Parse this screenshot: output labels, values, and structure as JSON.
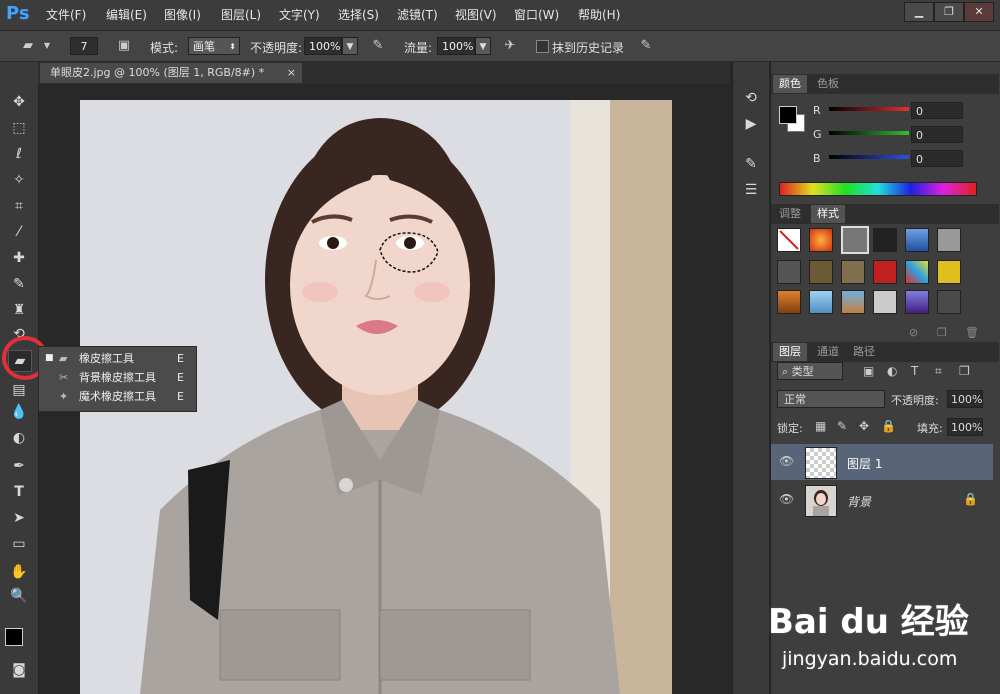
{
  "app": {
    "logo": "Ps"
  },
  "menu": [
    "文件(F)",
    "编辑(E)",
    "图像(I)",
    "图层(L)",
    "文字(Y)",
    "选择(S)",
    "滤镜(T)",
    "视图(V)",
    "窗口(W)",
    "帮助(H)"
  ],
  "window_controls": [
    "minimize-icon",
    "restore-icon",
    "close-icon"
  ],
  "options": {
    "brush_size": "7",
    "mode_label": "模式:",
    "mode_value": "画笔",
    "opacity_label": "不透明度:",
    "opacity_value": "100%",
    "flow_label": "流量:",
    "flow_value": "100%",
    "history_label": "抹到历史记录"
  },
  "document": {
    "tab_title": "单眼皮2.jpg @ 100% (图层 1, RGB/8#) *",
    "close": "×"
  },
  "tool_flyout": {
    "items": [
      {
        "label": "橡皮擦工具",
        "shortcut": "E",
        "selected": true
      },
      {
        "label": "背景橡皮擦工具",
        "shortcut": "E",
        "selected": false
      },
      {
        "label": "魔术橡皮擦工具",
        "shortcut": "E",
        "selected": false
      }
    ]
  },
  "color_panel": {
    "tabs": [
      "颜色",
      "色板"
    ],
    "channels": [
      {
        "name": "R",
        "value": "0",
        "color": "#e03030"
      },
      {
        "name": "G",
        "value": "0",
        "color": "#30c030"
      },
      {
        "name": "B",
        "value": "0",
        "color": "#3050e0"
      }
    ]
  },
  "styles_panel": {
    "tabs": [
      "调整",
      "样式"
    ]
  },
  "layers_panel": {
    "tabs": [
      "图层",
      "通道",
      "路径"
    ],
    "filter_label": "类型",
    "blend_mode": "正常",
    "opacity_label": "不透明度:",
    "opacity_value": "100%",
    "lock_label": "锁定:",
    "fill_label": "填充:",
    "fill_value": "100%",
    "layers": [
      {
        "name": "图层 1",
        "selected": true,
        "locked": false
      },
      {
        "name": "背景",
        "selected": false,
        "locked": true
      }
    ]
  },
  "watermark": {
    "brand": "Bai du 经验",
    "url": "jingyan.baidu.com"
  },
  "colors": {
    "accent": "#3ea6ff",
    "highlight_circle": "#e0303a",
    "selected_layer": "#586478"
  }
}
